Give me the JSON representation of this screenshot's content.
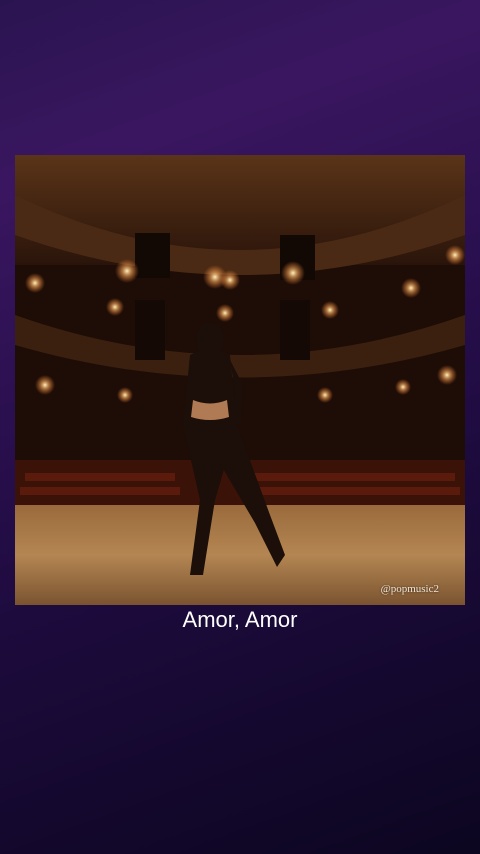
{
  "post": {
    "image_alt": "Dancer on an empty theatre stage facing the auditorium",
    "watermark": "@popmusic2",
    "caption": "Amor, Amor"
  },
  "colors": {
    "background_top": "#3a1660",
    "background_bottom": "#0c0620",
    "caption_text": "#ffffff"
  }
}
